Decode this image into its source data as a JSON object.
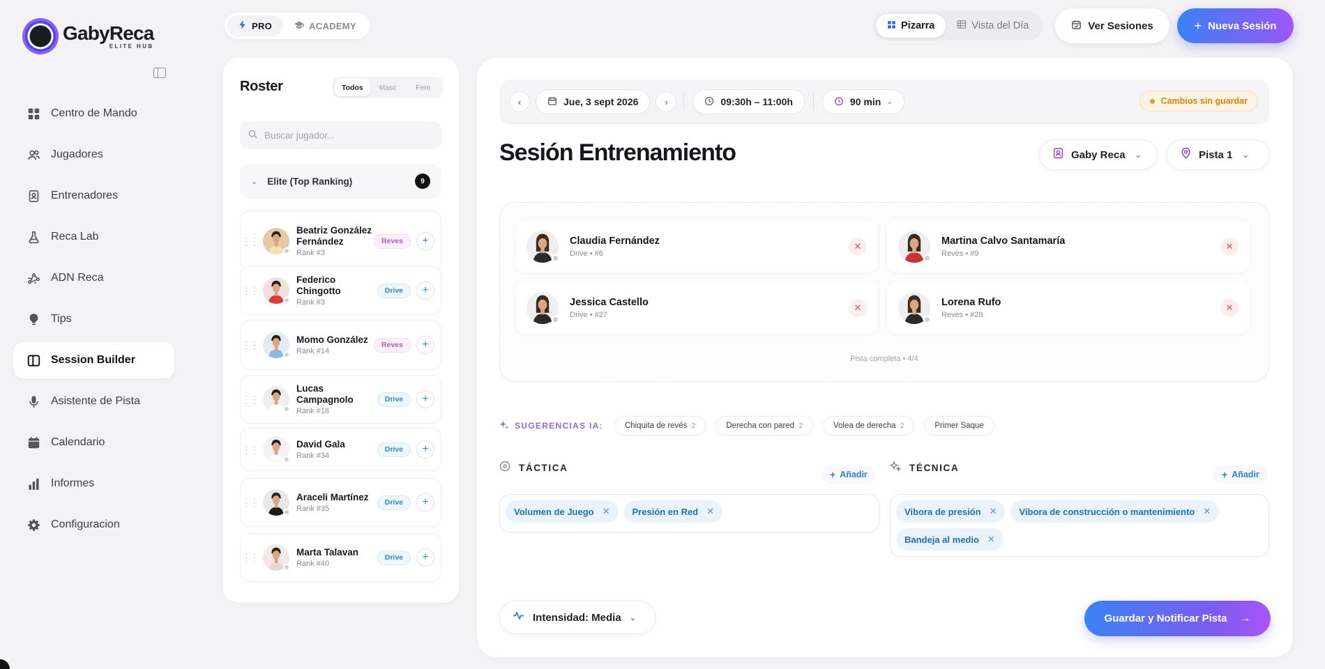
{
  "brand": {
    "name": "GabyReca",
    "subtitle": "ELITE HUB"
  },
  "sidebar": {
    "items": [
      {
        "label": "Centro de Mando",
        "icon": "grid-icon",
        "active": false
      },
      {
        "label": "Jugadores",
        "icon": "users-icon",
        "active": false
      },
      {
        "label": "Entrenadores",
        "icon": "id-badge-icon",
        "active": false
      },
      {
        "label": "Reca Lab",
        "icon": "flask-icon",
        "active": false
      },
      {
        "label": "ADN Reca",
        "icon": "network-icon",
        "active": false
      },
      {
        "label": "Tips",
        "icon": "lightbulb-icon",
        "active": false
      },
      {
        "label": "Session Builder",
        "icon": "book-icon",
        "active": true
      },
      {
        "label": "Asistente de Pista",
        "icon": "microphone-icon",
        "active": false
      },
      {
        "label": "Calendario",
        "icon": "calendar-icon",
        "active": false
      },
      {
        "label": "Informes",
        "icon": "bar-chart-icon",
        "active": false
      },
      {
        "label": "Configuracion",
        "icon": "gear-icon",
        "active": false
      }
    ]
  },
  "topbar": {
    "modes": [
      {
        "label": "PRO",
        "icon": "bolt-icon",
        "active": true
      },
      {
        "label": "ACADEMY",
        "icon": "graduation-cap-icon",
        "active": false
      }
    ],
    "views": [
      {
        "label": "Pizarra",
        "icon": "grid-icon",
        "active": true
      },
      {
        "label": "Vista del Día",
        "icon": "table-icon",
        "active": false
      }
    ],
    "ver_sesiones": "Ver Sesiones",
    "nueva_sesion": "Nueva Sesión"
  },
  "roster": {
    "title": "Roster",
    "filters": [
      {
        "label": "Todos",
        "active": true
      },
      {
        "label": "Masc",
        "active": false
      },
      {
        "label": "Fem",
        "active": false
      }
    ],
    "search_placeholder": "Buscar jugador...",
    "group": {
      "label": "Elite (Top Ranking)",
      "count": "9"
    },
    "players": [
      {
        "name": "Beatriz González Fernández",
        "rank": "Rank #3",
        "side": "Reves",
        "avatar_bg": "#e9c9a4",
        "shirt": "#f1e3b6"
      },
      {
        "name": "Federico Chingotto",
        "rank": "Rank #3",
        "side": "Drive",
        "avatar_bg": "#f1dede",
        "shirt": "#d83b3b"
      },
      {
        "name": "Momo González",
        "rank": "Rank #14",
        "side": "Reves",
        "avatar_bg": "#e3ebf2",
        "shirt": "#8fb7d9"
      },
      {
        "name": "Lucas Campagnolo",
        "rank": "Rank #18",
        "side": "Drive",
        "avatar_bg": "#eeeeee",
        "shirt": "#ffffff"
      },
      {
        "name": "David Gala",
        "rank": "Rank #34",
        "side": "Drive",
        "avatar_bg": "#f2f2f2",
        "shirt": "#fafafa"
      },
      {
        "name": "Araceli Martínez",
        "rank": "Rank #35",
        "side": "Drive",
        "avatar_bg": "#e8e8e8",
        "shirt": "#1c1c1c"
      },
      {
        "name": "Marta Talavan",
        "rank": "Rank #40",
        "side": "Drive",
        "avatar_bg": "#f1e8e8",
        "shirt": "#e9d5d5"
      }
    ]
  },
  "session": {
    "date": "Jue, 3 sept 2026",
    "time": "09:30h – 11:00h",
    "duration": "90 min",
    "unsaved": "Cambios sin guardar",
    "title": "Sesión Entrenamiento",
    "coach": "Gaby Reca",
    "court": "Pista 1",
    "court_players": [
      {
        "name": "Claudia Fernández",
        "meta": "Drive • #6",
        "shirt": "#2a2a2a"
      },
      {
        "name": "Martina Calvo Santamaría",
        "meta": "Reves • #9",
        "shirt": "#c73434"
      },
      {
        "name": "Jessica Castello",
        "meta": "Drive • #27",
        "shirt": "#2a2a2a"
      },
      {
        "name": "Lorena Rufo",
        "meta": "Reves • #28",
        "shirt": "#2a2a2a"
      }
    ],
    "court_footer": "Pista completa • 4/4"
  },
  "suggestions": {
    "label": "SUGERENCIAS IA:",
    "items": [
      {
        "label": "Chiquita de revés",
        "count": "·2"
      },
      {
        "label": "Derecha con pared",
        "count": "·2"
      },
      {
        "label": "Volea de derecha",
        "count": "·2"
      },
      {
        "label": "Primer Saque",
        "count": ""
      }
    ]
  },
  "tactica": {
    "title": "TÁCTICA",
    "add": "Añadir",
    "tags": [
      "Volumen de Juego",
      "Presión en Red"
    ]
  },
  "tecnica": {
    "title": "TÉCNICA",
    "add": "Añadir",
    "tags": [
      "Vibora de presión",
      "Vibora de construcción o mantenimiento",
      "Bandeja al medio"
    ]
  },
  "intensity": "Intensidad: Media",
  "save_button": "Guardar y Notificar Pista",
  "colors": {
    "accent_start": "#3b82f6",
    "accent_end": "#a855f7",
    "warning": "#d4870e"
  }
}
